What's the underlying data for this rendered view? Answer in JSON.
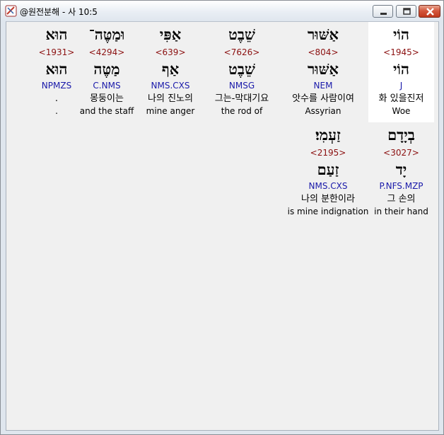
{
  "window": {
    "title": "@원전분해 - 사 10:5",
    "icon": "app-icon",
    "controls": [
      "minimize-icon",
      "maximize-icon",
      "close-icon"
    ]
  },
  "words": [
    {
      "hebrew": "הוֹי",
      "strong": "<1945>",
      "lemma": "הוֹי",
      "morph": "J",
      "korean": "화 있을진저",
      "english": "Woe",
      "highlighted": true
    },
    {
      "hebrew": "אַשּׁוּר",
      "strong": "<804>",
      "lemma": "אַשּׁוּר",
      "morph": "NEM",
      "korean": "앗수를 사람이여",
      "english": "Assyrian",
      "highlighted": false
    },
    {
      "hebrew": "שֵׁבֶט",
      "strong": "<7626>",
      "lemma": "שֵׁבֶט",
      "morph": "NMSG",
      "korean": "그는-막대기요",
      "english": "the rod of",
      "highlighted": false
    },
    {
      "hebrew": "אַפִּי",
      "strong": "<639>",
      "lemma": "אַף",
      "morph": "NMS.CXS",
      "korean": "나의 진노의",
      "english": "mine anger",
      "highlighted": false
    },
    {
      "hebrew": "וּמַטֶּה־",
      "strong": "<4294>",
      "lemma": "מַטֶּה",
      "morph": "C.NMS",
      "korean": "몽둥이는",
      "english": "and the staff",
      "highlighted": false
    },
    {
      "hebrew": "הוּא",
      "strong": "<1931>",
      "lemma": "הוּא",
      "morph": "NPMZS",
      "korean": ".",
      "english": ".",
      "highlighted": false
    },
    {
      "hebrew": "בְיָדָם",
      "strong": "<3027>",
      "lemma": "יָד",
      "morph": "P.NFS.MZP",
      "korean": "그 손의",
      "english": "in their hand",
      "highlighted": false
    },
    {
      "hebrew": "זַעְמִי׃",
      "strong": "<2195>",
      "lemma": "זַעַם",
      "morph": "NMS.CXS",
      "korean": "나의 분한이라",
      "english": "is mine indignation",
      "highlighted": false
    }
  ]
}
